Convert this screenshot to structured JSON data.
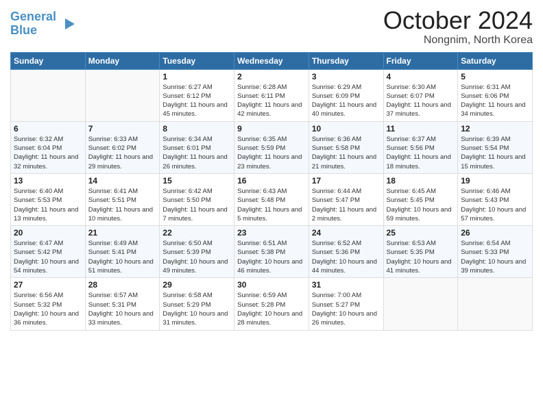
{
  "header": {
    "logo_line1": "General",
    "logo_line2": "Blue",
    "month_title": "October 2024",
    "location": "Nongnim, North Korea"
  },
  "weekdays": [
    "Sunday",
    "Monday",
    "Tuesday",
    "Wednesday",
    "Thursday",
    "Friday",
    "Saturday"
  ],
  "weeks": [
    [
      {
        "day": "",
        "info": ""
      },
      {
        "day": "",
        "info": ""
      },
      {
        "day": "1",
        "info": "Sunrise: 6:27 AM\nSunset: 6:12 PM\nDaylight: 11 hours and 45 minutes."
      },
      {
        "day": "2",
        "info": "Sunrise: 6:28 AM\nSunset: 6:11 PM\nDaylight: 11 hours and 42 minutes."
      },
      {
        "day": "3",
        "info": "Sunrise: 6:29 AM\nSunset: 6:09 PM\nDaylight: 11 hours and 40 minutes."
      },
      {
        "day": "4",
        "info": "Sunrise: 6:30 AM\nSunset: 6:07 PM\nDaylight: 11 hours and 37 minutes."
      },
      {
        "day": "5",
        "info": "Sunrise: 6:31 AM\nSunset: 6:06 PM\nDaylight: 11 hours and 34 minutes."
      }
    ],
    [
      {
        "day": "6",
        "info": "Sunrise: 6:32 AM\nSunset: 6:04 PM\nDaylight: 11 hours and 32 minutes."
      },
      {
        "day": "7",
        "info": "Sunrise: 6:33 AM\nSunset: 6:02 PM\nDaylight: 11 hours and 29 minutes."
      },
      {
        "day": "8",
        "info": "Sunrise: 6:34 AM\nSunset: 6:01 PM\nDaylight: 11 hours and 26 minutes."
      },
      {
        "day": "9",
        "info": "Sunrise: 6:35 AM\nSunset: 5:59 PM\nDaylight: 11 hours and 23 minutes."
      },
      {
        "day": "10",
        "info": "Sunrise: 6:36 AM\nSunset: 5:58 PM\nDaylight: 11 hours and 21 minutes."
      },
      {
        "day": "11",
        "info": "Sunrise: 6:37 AM\nSunset: 5:56 PM\nDaylight: 11 hours and 18 minutes."
      },
      {
        "day": "12",
        "info": "Sunrise: 6:39 AM\nSunset: 5:54 PM\nDaylight: 11 hours and 15 minutes."
      }
    ],
    [
      {
        "day": "13",
        "info": "Sunrise: 6:40 AM\nSunset: 5:53 PM\nDaylight: 11 hours and 13 minutes."
      },
      {
        "day": "14",
        "info": "Sunrise: 6:41 AM\nSunset: 5:51 PM\nDaylight: 11 hours and 10 minutes."
      },
      {
        "day": "15",
        "info": "Sunrise: 6:42 AM\nSunset: 5:50 PM\nDaylight: 11 hours and 7 minutes."
      },
      {
        "day": "16",
        "info": "Sunrise: 6:43 AM\nSunset: 5:48 PM\nDaylight: 11 hours and 5 minutes."
      },
      {
        "day": "17",
        "info": "Sunrise: 6:44 AM\nSunset: 5:47 PM\nDaylight: 11 hours and 2 minutes."
      },
      {
        "day": "18",
        "info": "Sunrise: 6:45 AM\nSunset: 5:45 PM\nDaylight: 10 hours and 59 minutes."
      },
      {
        "day": "19",
        "info": "Sunrise: 6:46 AM\nSunset: 5:43 PM\nDaylight: 10 hours and 57 minutes."
      }
    ],
    [
      {
        "day": "20",
        "info": "Sunrise: 6:47 AM\nSunset: 5:42 PM\nDaylight: 10 hours and 54 minutes."
      },
      {
        "day": "21",
        "info": "Sunrise: 6:49 AM\nSunset: 5:41 PM\nDaylight: 10 hours and 51 minutes."
      },
      {
        "day": "22",
        "info": "Sunrise: 6:50 AM\nSunset: 5:39 PM\nDaylight: 10 hours and 49 minutes."
      },
      {
        "day": "23",
        "info": "Sunrise: 6:51 AM\nSunset: 5:38 PM\nDaylight: 10 hours and 46 minutes."
      },
      {
        "day": "24",
        "info": "Sunrise: 6:52 AM\nSunset: 5:36 PM\nDaylight: 10 hours and 44 minutes."
      },
      {
        "day": "25",
        "info": "Sunrise: 6:53 AM\nSunset: 5:35 PM\nDaylight: 10 hours and 41 minutes."
      },
      {
        "day": "26",
        "info": "Sunrise: 6:54 AM\nSunset: 5:33 PM\nDaylight: 10 hours and 39 minutes."
      }
    ],
    [
      {
        "day": "27",
        "info": "Sunrise: 6:56 AM\nSunset: 5:32 PM\nDaylight: 10 hours and 36 minutes."
      },
      {
        "day": "28",
        "info": "Sunrise: 6:57 AM\nSunset: 5:31 PM\nDaylight: 10 hours and 33 minutes."
      },
      {
        "day": "29",
        "info": "Sunrise: 6:58 AM\nSunset: 5:29 PM\nDaylight: 10 hours and 31 minutes."
      },
      {
        "day": "30",
        "info": "Sunrise: 6:59 AM\nSunset: 5:28 PM\nDaylight: 10 hours and 28 minutes."
      },
      {
        "day": "31",
        "info": "Sunrise: 7:00 AM\nSunset: 5:27 PM\nDaylight: 10 hours and 26 minutes."
      },
      {
        "day": "",
        "info": ""
      },
      {
        "day": "",
        "info": ""
      }
    ]
  ]
}
